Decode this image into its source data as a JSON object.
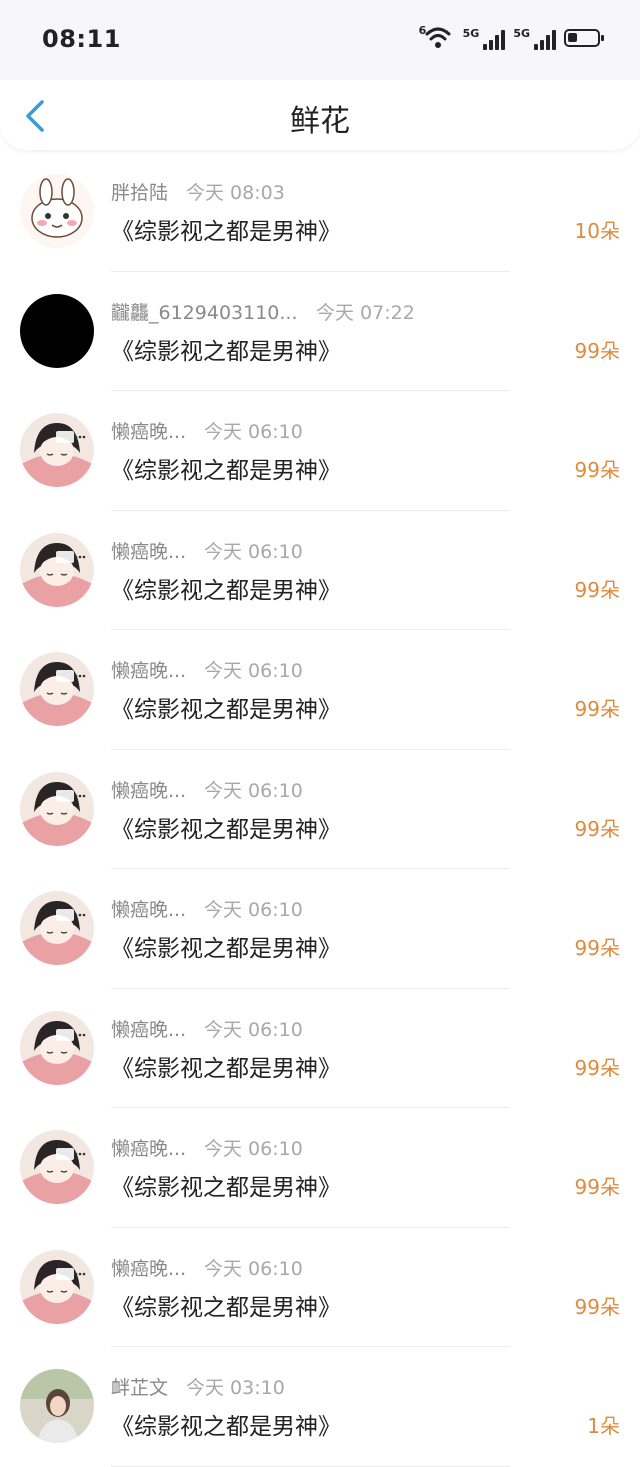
{
  "status_bar": {
    "time": "08:11",
    "wifi_label": "6",
    "signal1_label": "5G",
    "signal2_label": "5G"
  },
  "nav": {
    "title": "鲜花",
    "back_icon": "chevron-left-icon",
    "accent_color": "#3a9ad9"
  },
  "records": [
    {
      "user": "胖拾陆",
      "time": "今天 08:03",
      "title": "《综影视之都是男神》",
      "count": "10朵",
      "avatar": "bunny"
    },
    {
      "user": "龖龘_6129403110...",
      "time": "今天 07:22",
      "title": "《综影视之都是男神》",
      "count": "99朵",
      "avatar": "black"
    },
    {
      "user": "懒癌晚...",
      "time": "今天 06:10",
      "title": "《综影视之都是男神》",
      "count": "99朵",
      "avatar": "anime"
    },
    {
      "user": "懒癌晚...",
      "time": "今天 06:10",
      "title": "《综影视之都是男神》",
      "count": "99朵",
      "avatar": "anime"
    },
    {
      "user": "懒癌晚...",
      "time": "今天 06:10",
      "title": "《综影视之都是男神》",
      "count": "99朵",
      "avatar": "anime"
    },
    {
      "user": "懒癌晚...",
      "time": "今天 06:10",
      "title": "《综影视之都是男神》",
      "count": "99朵",
      "avatar": "anime"
    },
    {
      "user": "懒癌晚...",
      "time": "今天 06:10",
      "title": "《综影视之都是男神》",
      "count": "99朵",
      "avatar": "anime"
    },
    {
      "user": "懒癌晚...",
      "time": "今天 06:10",
      "title": "《综影视之都是男神》",
      "count": "99朵",
      "avatar": "anime"
    },
    {
      "user": "懒癌晚...",
      "time": "今天 06:10",
      "title": "《综影视之都是男神》",
      "count": "99朵",
      "avatar": "anime"
    },
    {
      "user": "懒癌晚...",
      "time": "今天 06:10",
      "title": "《综影视之都是男神》",
      "count": "99朵",
      "avatar": "anime"
    },
    {
      "user": "衅芷文",
      "time": "今天 03:10",
      "title": "《综影视之都是男神》",
      "count": "1朵",
      "avatar": "photo"
    }
  ],
  "colors": {
    "count": "#e08a3c",
    "username": "#8a8a8a",
    "timestamp": "#a8a8a8"
  }
}
